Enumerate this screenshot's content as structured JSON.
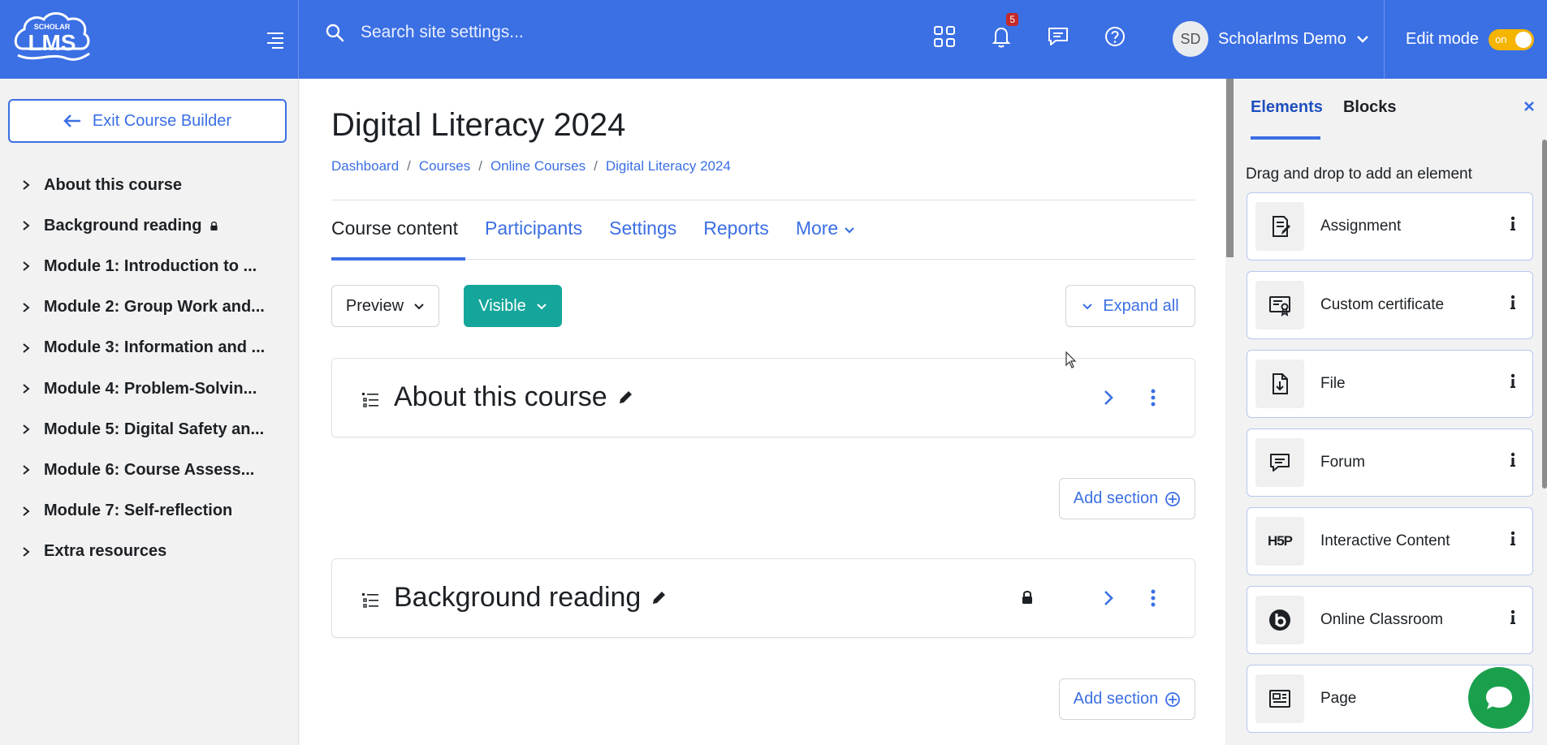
{
  "header": {
    "logo_top": "SCHOLAR",
    "logo_main": "LMS",
    "search_placeholder": "Search site settings...",
    "notification_count": "5",
    "avatar_initials": "SD",
    "user_name": "Scholarlms Demo",
    "edit_mode_label": "Edit mode",
    "edit_toggle_text": "on"
  },
  "sidebar": {
    "exit_label": "Exit Course Builder",
    "items": [
      {
        "label": "About this course"
      },
      {
        "label": "Background reading"
      },
      {
        "label": "Module 1: Introduction to ..."
      },
      {
        "label": "Module 2: Group Work and..."
      },
      {
        "label": "Module 3: Information and ..."
      },
      {
        "label": "Module 4: Problem-Solvin..."
      },
      {
        "label": "Module 5: Digital Safety an..."
      },
      {
        "label": "Module 6: Course Assess..."
      },
      {
        "label": "Module 7: Self-reflection"
      },
      {
        "label": "Extra resources"
      }
    ]
  },
  "main": {
    "title": "Digital Literacy 2024",
    "breadcrumbs": [
      "Dashboard",
      "Courses",
      "Online Courses",
      "Digital Literacy 2024"
    ],
    "tabs": [
      "Course content",
      "Participants",
      "Settings",
      "Reports",
      "More"
    ],
    "preview_label": "Preview",
    "visible_label": "Visible",
    "expand_label": "Expand all",
    "sections": [
      {
        "title": "About this course"
      },
      {
        "title": "Background reading"
      }
    ],
    "add_section_label": "Add section"
  },
  "drawer": {
    "tabs": [
      "Elements",
      "Blocks"
    ],
    "hint": "Drag and drop to add an element",
    "elements": [
      {
        "label": "Assignment",
        "icon": "assignment-icon"
      },
      {
        "label": "Custom certificate",
        "icon": "certificate-icon"
      },
      {
        "label": "File",
        "icon": "file-icon"
      },
      {
        "label": "Forum",
        "icon": "forum-icon"
      },
      {
        "label": "Interactive Content",
        "icon": "h5p-icon",
        "icon_text": "H5P"
      },
      {
        "label": "Online Classroom",
        "icon": "bigbluebutton-icon"
      },
      {
        "label": "Page",
        "icon": "page-icon"
      }
    ]
  },
  "colors": {
    "primary": "#3b6fe4",
    "visible_button": "#14a69a",
    "toggle": "#f4b400",
    "chat": "#1aa04d",
    "badge": "#c62828"
  }
}
